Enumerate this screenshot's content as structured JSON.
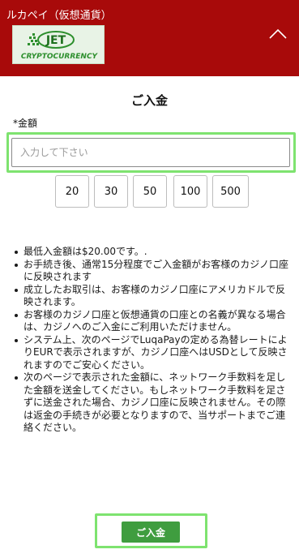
{
  "header": {
    "title": "ルカペイ（仮想通貨）",
    "logo_text": "JET",
    "logo_subtext": "CRYPTOCURRENCY",
    "collapse_icon": "chevron-up-icon"
  },
  "deposit": {
    "title": "ご入金",
    "amount_label": "*金額",
    "amount_placeholder": "入力して下さい",
    "amount_value": "",
    "presets": [
      "20",
      "30",
      "50",
      "100",
      "500"
    ],
    "notes": [
      "最低入金額は$20.00です。.",
      "お手続き後、通常15分程度でご入金額がお客様のカジノ口座に反映されます",
      "成立したお取引は、お客様のカジノ口座にアメリカドルで反映されます。",
      "お客様のカジノ口座と仮想通貨の口座との名義が異なる場合は、カジノへのご入金にご利用いただけません。",
      "システム上、次のページでLuqaPayの定める為替レートによりEURで表示されますが、カジノ口座へはUSDとして反映されますのでご安心ください。",
      "次のページで表示された金額に、ネットワーク手数料を足した金額を送金してください。もしネットワーク手数料を足さずに送金された場合、カジノ口座に反映されません。その際は返金の手続きが必要となりますので、当サポートまでご連絡ください。"
    ],
    "submit_label": "ご入金"
  },
  "colors": {
    "header_bg": "#a80a0a",
    "highlight": "#7ee36f",
    "submit_bg": "#3f9d3f"
  }
}
